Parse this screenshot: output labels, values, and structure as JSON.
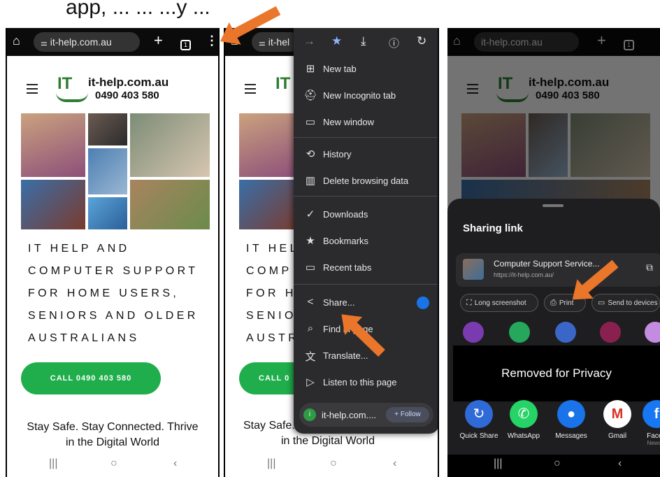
{
  "caption": "app, ... ... ...y ...",
  "browser": {
    "url": "it-help.com.au",
    "url_truncated": "it-hel",
    "tabs_count": "1"
  },
  "site": {
    "logo_mark": "IT",
    "title": "it-help.com.au",
    "phone": "0490 403 580",
    "headline": [
      "IT HELP AND",
      "COMPUTER SUPPORT",
      "FOR HOME USERS,",
      "SENIORS AND OLDER",
      "AUSTRALIANS"
    ],
    "headline_cut": [
      "IT HEL",
      "COMP",
      "FOR H",
      "SENIO",
      "AUSTR"
    ],
    "cta": "CALL 0490 403 580",
    "cta_cut": "CALL 0",
    "tagline": [
      "Stay Safe. Stay Connected. Thrive",
      "in the Digital World"
    ],
    "tagline_cut": "Stay Safe."
  },
  "menu": {
    "items": [
      {
        "icon": "new-tab-icon",
        "label": "New tab"
      },
      {
        "icon": "incognito-icon",
        "label": "New Incognito tab"
      },
      {
        "icon": "new-window-icon",
        "label": "New window"
      },
      {
        "icon": "history-icon",
        "label": "History"
      },
      {
        "icon": "trash-icon",
        "label": "Delete browsing data"
      },
      {
        "icon": "download-icon",
        "label": "Downloads"
      },
      {
        "icon": "star-icon",
        "label": "Bookmarks"
      },
      {
        "icon": "recent-tabs-icon",
        "label": "Recent tabs"
      },
      {
        "icon": "share-icon",
        "label": "Share..."
      },
      {
        "icon": "find-icon",
        "label": "Find in page"
      },
      {
        "icon": "translate-icon",
        "label": "Translate..."
      },
      {
        "icon": "listen-icon",
        "label": "Listen to this page"
      }
    ],
    "follow_site": "it-help.com....",
    "follow_label": "+ Follow"
  },
  "share": {
    "title": "Sharing link",
    "link_name": "Computer Support Service...",
    "link_url": "https://it-help.com.au/",
    "chips": [
      "Long screenshot",
      "Print",
      "Send to devices"
    ],
    "privacy": "Removed for Privacy",
    "apps": [
      {
        "name": "Quick Share",
        "color": "#2f6bd6"
      },
      {
        "name": "WhatsApp",
        "color": "#25d366"
      },
      {
        "name": "Messages",
        "color": "#1a73e8"
      },
      {
        "name": "Gmail",
        "color": "#ffffff"
      },
      {
        "name": "Faceb",
        "sub": "News F",
        "color": "#1877f2"
      }
    ]
  },
  "colors": {
    "accent": "#e9762b",
    "cta": "#1fae4b",
    "logo": "#2e7d32"
  }
}
